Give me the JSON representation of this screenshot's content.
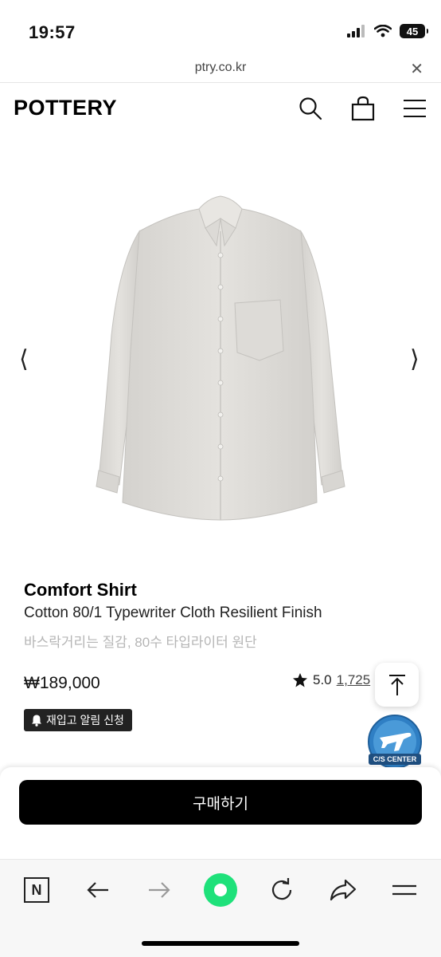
{
  "status": {
    "time": "19:57",
    "battery": "45"
  },
  "browser": {
    "url": "ptry.co.kr"
  },
  "header": {
    "logo": "POTTERY"
  },
  "product": {
    "name": "Comfort Shirt",
    "subtitle": "Cotton 80/1 Typewriter Cloth Resilient Finish",
    "korean_desc": "바스락거리는 질감, 80수 타입라이터 원단",
    "price": "₩189,000",
    "rating": "5.0",
    "review_count": "1,725",
    "restock_label": "재입고 알림 신청",
    "image_color": "#dedcd8"
  },
  "cs_badge": {
    "label": "C/S CENTER"
  },
  "buy": {
    "label": "구매하기"
  },
  "toolbar": {
    "home_label": "N",
    "accent": "#1ee17a"
  },
  "colors": {
    "buy_button": "#000000",
    "restock_button": "#222222",
    "badge_blue": "#2f7fc4"
  }
}
